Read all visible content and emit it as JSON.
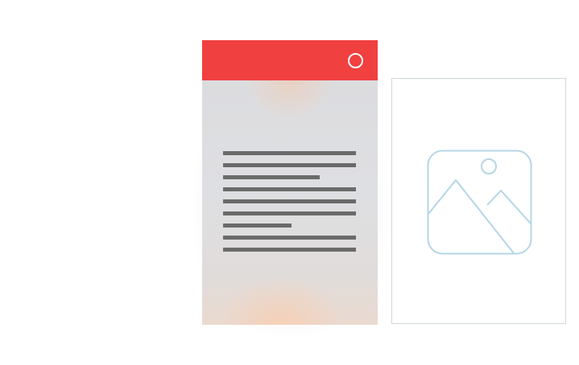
{
  "mockup": {
    "modal_card": {
      "header_color": "#f04040",
      "header_icon": "circle-icon",
      "body_color": "#e1e1e3",
      "text_line_color": "#6a6a6a",
      "placeholder_paragraphs": 3
    },
    "image_placeholder": {
      "icon": "image-placeholder-icon",
      "stroke_color": "#b5d6e6",
      "border_color": "#cfd8dc"
    }
  }
}
